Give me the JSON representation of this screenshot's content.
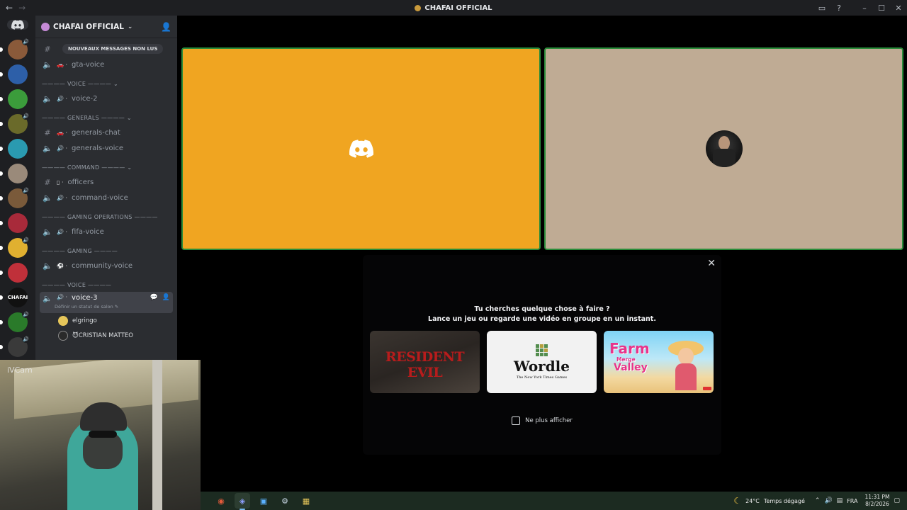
{
  "window": {
    "title": "CHAFAI OFFICIAL"
  },
  "guild": {
    "name": "CHAFAI OFFICIAL",
    "rail_servers": [
      {
        "name": "server-1",
        "color": "#8a5a3a",
        "speaker": true
      },
      {
        "name": "server-2",
        "color": "#2d5fa8",
        "speaker": false
      },
      {
        "name": "server-3",
        "color": "#3b9c3b",
        "speaker": false
      },
      {
        "name": "server-4",
        "color": "#6a6a2a",
        "speaker": true
      },
      {
        "name": "server-5",
        "color": "#2a9ab0",
        "speaker": false
      },
      {
        "name": "server-6",
        "color": "#9a8a7a",
        "speaker": false
      },
      {
        "name": "server-7",
        "color": "#7a5a3a",
        "speaker": true
      },
      {
        "name": "server-8",
        "color": "#a82a3a",
        "speaker": false
      },
      {
        "name": "server-9",
        "color": "#e0b030",
        "speaker": true
      },
      {
        "name": "server-10",
        "color": "#c0303a",
        "speaker": false
      },
      {
        "name": "server-11",
        "label": "CHAFAI",
        "color": "#111111",
        "speaker": false
      },
      {
        "name": "server-12",
        "color": "#2a7a2a",
        "speaker": true
      },
      {
        "name": "server-13",
        "color": "#3a3a3a",
        "speaker": true
      },
      {
        "name": "server-14",
        "color": "#2a4a8a",
        "speaker": false
      }
    ]
  },
  "channels": {
    "unread_pill": "NOUVEAUX MESSAGES NON LUS",
    "gta_voice": "gta-voice",
    "cat_voice": "———— VOICE ————",
    "voice_2": "voice-2",
    "cat_generals": "———— GENERALS ————",
    "generals_chat": "generals-chat",
    "generals_voice": "generals-voice",
    "cat_command": "———— COMMAND ————",
    "officers": "officers",
    "command_voice": "command-voice",
    "cat_gaming_ops": "———— GAMING OPERATIONS ————",
    "fifa_voice": "fifa-voice",
    "cat_gaming": "———— GAMING ————",
    "community_voice": "community-voice",
    "cat_voice_2": "———— VOICE ————",
    "voice_3": "voice-3",
    "voice_3_status": "Définir un statut de salon",
    "members": [
      {
        "name": "elgringo",
        "color": "#e6c65a"
      },
      {
        "name": "😈CRISTIAN MATTEO",
        "color": "#2a2a2a"
      }
    ]
  },
  "activity": {
    "question": "Tu cherches quelque chose à faire ?",
    "subtitle": "Lance un jeu ou regarde une vidéo en groupe en un instant.",
    "cards": {
      "resident_evil": "RESIDENT EVIL",
      "wordle": "Wordle",
      "wordle_sub": "The New York Times Games",
      "farm_title": "Farm",
      "farm_sub": "Merge",
      "farm_valley": "Valley"
    },
    "dont_show": "Ne plus afficher"
  },
  "webcam": {
    "label": "iVCam"
  },
  "taskbar": {
    "weather_temp": "24°C",
    "weather_desc": "Temps dégagé",
    "lang": "FRA",
    "time": "11:31 PM",
    "date": "8/2/2026"
  },
  "colors": {
    "tile_a": "#f0a521",
    "tile_b": "#bfab94",
    "speaking_border": "#2a8c3a"
  }
}
